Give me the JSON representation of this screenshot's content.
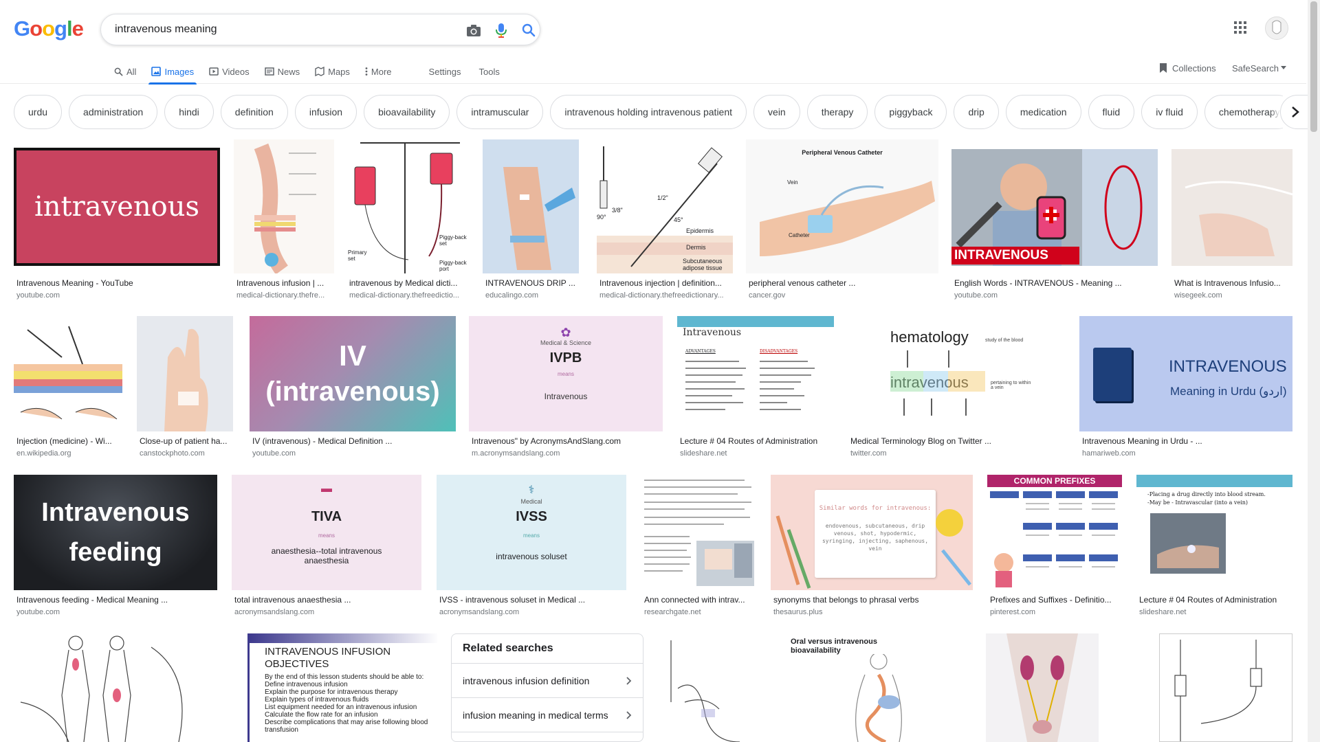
{
  "logo": {
    "letters": [
      "G",
      "o",
      "o",
      "g",
      "l",
      "e"
    ]
  },
  "search": {
    "query": "intravenous meaning"
  },
  "tabs": [
    {
      "label": "All",
      "icon": "search-icon"
    },
    {
      "label": "Images",
      "icon": "image-icon"
    },
    {
      "label": "Videos",
      "icon": "video-icon"
    },
    {
      "label": "News",
      "icon": "news-icon"
    },
    {
      "label": "Maps",
      "icon": "map-icon"
    },
    {
      "label": "More",
      "icon": "more-icon"
    }
  ],
  "tools": {
    "settings": "Settings",
    "tools": "Tools"
  },
  "collections": "Collections",
  "safesearch": "SafeSearch",
  "chips": [
    "urdu",
    "administration",
    "hindi",
    "definition",
    "infusion",
    "bioavailability",
    "intramuscular",
    "intravenous holding intravenous patient",
    "vein",
    "therapy",
    "piggyback",
    "drip",
    "medication",
    "fluid",
    "iv fluid",
    "chemotherapy"
  ],
  "results": [
    {
      "caption": "Intravenous Meaning - YouTube",
      "source": "youtube.com",
      "thumb_text": "intravenous"
    },
    {
      "caption": "Intravenous infusion | ...",
      "source": "medical-dictionary.thefre..."
    },
    {
      "caption": "intravenous by Medical dicti...",
      "source": "medical-dictionary.thefreedictio...",
      "thumb_text": [
        "Piggy-back set",
        "Primary set",
        "Piggy-back port"
      ]
    },
    {
      "caption": "INTRAVENOUS DRIP ...",
      "source": "educalingo.com"
    },
    {
      "caption": "Intravenous injection | definition...",
      "source": "medical-dictionary.thefreedictionary...",
      "thumb_text": [
        "3/8\"",
        "90°",
        "1/2\"",
        "45°",
        "Epidermis",
        "Dermis",
        "Subcutaneous adipose tissue"
      ]
    },
    {
      "caption": "peripheral venous catheter ...",
      "source": "cancer.gov",
      "thumb_text": [
        "Peripheral Venous Catheter",
        "Vein",
        "Catheter"
      ]
    },
    {
      "caption": "English Words - INTRAVENOUS - Meaning ...",
      "source": "youtube.com",
      "thumb_text": "INTRAVENOUS"
    },
    {
      "caption": "What is Intravenous Infusio...",
      "source": "wisegeek.com"
    },
    {
      "caption": "Injection (medicine) - Wi...",
      "source": "en.wikipedia.org"
    },
    {
      "caption": "Close-up of patient ha...",
      "source": "canstockphoto.com"
    },
    {
      "caption": "IV (intravenous) - Medical Definition ...",
      "source": "youtube.com",
      "thumb_text": [
        "IV",
        "(intravenous)"
      ]
    },
    {
      "caption": "Intravenous\" by AcronymsAndSlang.com",
      "source": "m.acronymsandslang.com",
      "thumb_text": [
        "Medical & Science",
        "IVPB",
        "means",
        "Intravenous"
      ]
    },
    {
      "caption": "Lecture # 04 Routes of Administration",
      "source": "slideshare.net",
      "thumb_text": [
        "Intravenous",
        "ADVANTAGES",
        "DISADVANTAGES"
      ]
    },
    {
      "caption": "Medical Terminology Blog on Twitter ...",
      "source": "twitter.com",
      "thumb_text": [
        "hematology",
        "intravenous",
        "study of the blood",
        "pertaining to within a vein"
      ]
    },
    {
      "caption": "Intravenous Meaning in Urdu - ...",
      "source": "hamariweb.com",
      "thumb_text": [
        "INTRAVENOUS",
        "Meaning in Urdu (اردو)"
      ]
    },
    {
      "caption": "Intravenous feeding - Medical Meaning ...",
      "source": "youtube.com",
      "thumb_text": [
        "Intravenous",
        "feeding"
      ]
    },
    {
      "caption": "total intravenous anaesthesia ...",
      "source": "acronymsandslang.com",
      "thumb_text": [
        "TIVA",
        "means",
        "anaesthesia--total intravenous anaesthesia"
      ]
    },
    {
      "caption": "IVSS - intravenous soluset in Medical ...",
      "source": "acronymsandslang.com",
      "thumb_text": [
        "Medical",
        "IVSS",
        "means",
        "intravenous soluset"
      ]
    },
    {
      "caption": "Ann connected with intrav...",
      "source": "researchgate.net"
    },
    {
      "caption": "synonyms that belongs to phrasal verbs",
      "source": "thesaurus.plus",
      "thumb_text": [
        "Similar words for intravenous:",
        "endovenous, subcutaneous, drip venous, shot, hypodermic, syringing, injecting, saphenous, vein"
      ]
    },
    {
      "caption": "Prefixes and Suffixes - Definitio...",
      "source": "pinterest.com",
      "thumb_text": "COMMON PREFIXES"
    },
    {
      "caption": "Lecture # 04 Routes of Administration",
      "source": "slideshare.net",
      "thumb_text": [
        "Intravenous",
        "-Placing a drug directly into blood stream.",
        "-May be - Intravascular (into a vein)"
      ]
    }
  ],
  "row4": [
    {
      "name": "injection-sites-thumb"
    },
    {
      "name": "infusion-objectives-thumb",
      "thumb_text": [
        "INTRAVENOUS INFUSION",
        "OBJECTIVES",
        "By the end of this lesson students should be able to:",
        "Define intravenous infusion",
        "Explain the purpose for intravenous therapy",
        "Explain types of intravenous fluids",
        "List equipment needed for an intravenous infusion",
        "Calculate the flow rate for an infusion",
        "Describe complications that may arise following blood transfusion"
      ]
    },
    {
      "name": "catheter-hand-thumb"
    },
    {
      "name": "bioavailability-thumb",
      "thumb_text": [
        "Oral versus intravenous",
        "bioavailability"
      ]
    },
    {
      "name": "kidney-thumb"
    },
    {
      "name": "piggyback-thumb"
    }
  ],
  "related": {
    "title": "Related searches",
    "items": [
      "intravenous infusion definition",
      "infusion meaning in medical terms"
    ]
  },
  "colors": {
    "accent": "#1a73e8",
    "text": "#202124",
    "muted": "#70757a"
  }
}
